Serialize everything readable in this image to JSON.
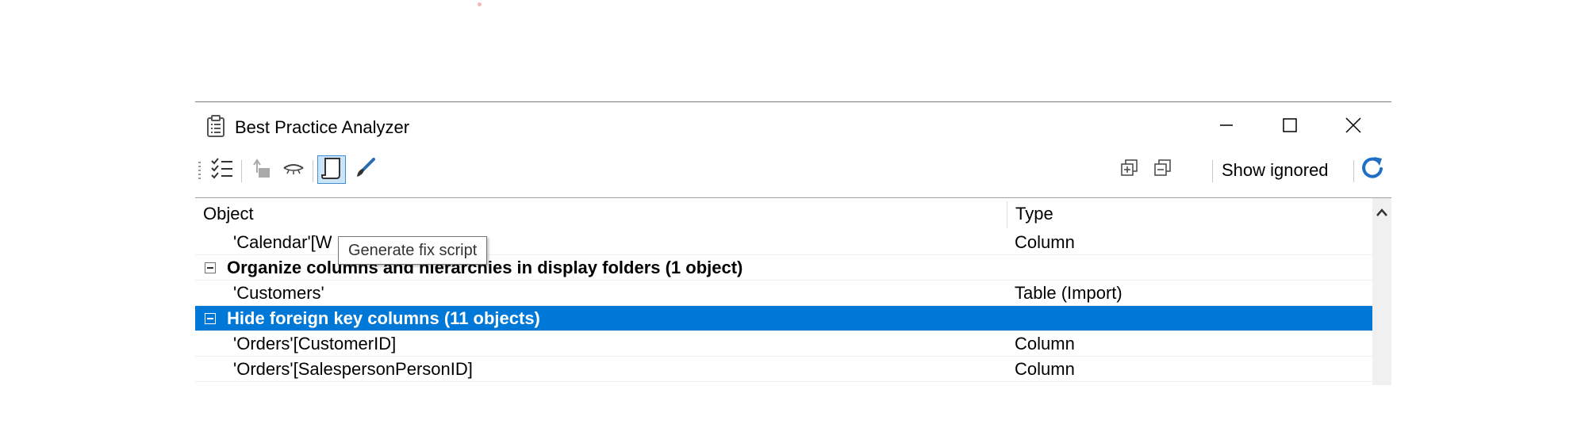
{
  "window": {
    "title": "Best Practice Analyzer",
    "buttons": {
      "minimize": "minimize-icon",
      "maximize": "maximize-icon",
      "close": "close-icon"
    }
  },
  "toolbar": {
    "show_ignored_label": "Show ignored",
    "icons": [
      "checklist-icon",
      "goto-object-icon",
      "ignore-eye-icon",
      "script-icon",
      "brush-icon",
      "expand-all-icon",
      "collapse-all-icon",
      "refresh-icon"
    ]
  },
  "tooltip": {
    "text": "Generate fix script"
  },
  "grid": {
    "columns": {
      "object": "Object",
      "type": "Type"
    },
    "rows": [
      {
        "kind": "item",
        "object": "'Calendar'[W",
        "type": "Column"
      },
      {
        "kind": "group",
        "object": "Organize columns and hierarchies in display folders (1 object)",
        "type": ""
      },
      {
        "kind": "item",
        "object": "'Customers'",
        "type": "Table (Import)"
      },
      {
        "kind": "group",
        "object": "Hide foreign key columns (11 objects)",
        "type": "",
        "selected": true
      },
      {
        "kind": "item",
        "object": "'Orders'[CustomerID]",
        "type": "Column"
      },
      {
        "kind": "item",
        "object": "'Orders'[SalespersonPersonID]",
        "type": "Column"
      }
    ]
  },
  "colors": {
    "selection": "#0078d7",
    "refresh_icon": "#1e6fc5",
    "active_button": "#cce4f7"
  }
}
